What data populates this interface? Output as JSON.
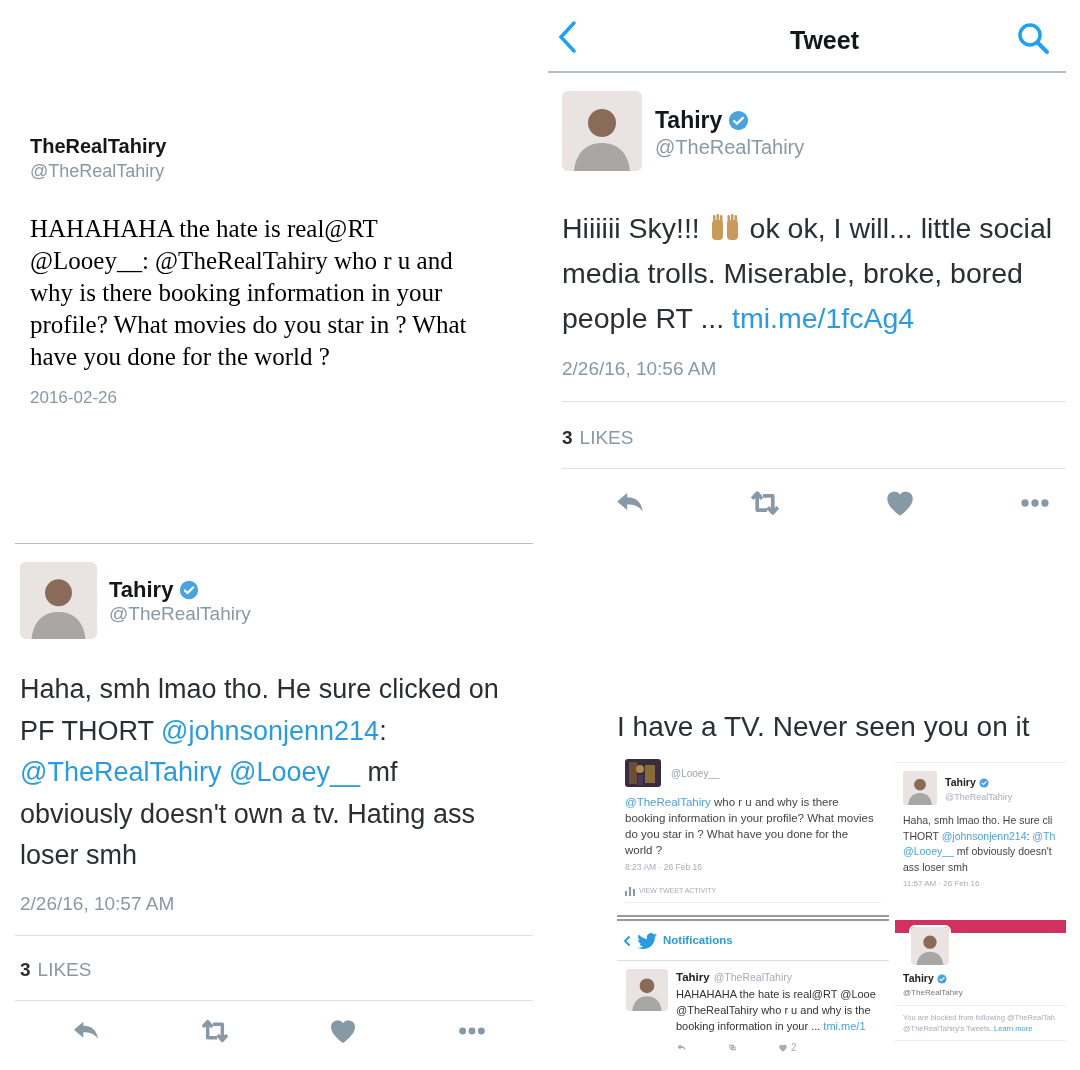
{
  "quote_card": {
    "name": "TheRealTahiry",
    "handle": "@TheRealTahiry",
    "text": "HAHAHAHA the hate is real@RT @Looey__: @TheRealTahiry who r u and why is there booking information in your profile? What movies do you star in ? What have you done for the world ?",
    "date": "2016-02-26"
  },
  "tweet_detail": {
    "header_title": "Tweet",
    "name": "Tahiry",
    "verified": true,
    "handle": "@TheRealTahiry",
    "lines": [
      [
        {
          "kind": "plain",
          "text": "Hiiiiii Sky!!! "
        },
        {
          "kind": "raised_hands"
        },
        {
          "kind": "plain",
          "text": " ok ok, I will... little social"
        }
      ],
      [
        {
          "kind": "plain",
          "text": "media trolls. Miserable, broke, bored"
        }
      ],
      [
        {
          "kind": "plain",
          "text": "people RT ... "
        },
        {
          "kind": "link",
          "text": "tmi.me/1fcAg4"
        }
      ]
    ],
    "timestamp": "2/26/16, 10:56 AM",
    "likes_count": "3",
    "likes_label": "LIKES"
  },
  "reply_tweet": {
    "name": "Tahiry",
    "verified": true,
    "handle": "@TheRealTahiry",
    "lines": [
      [
        {
          "kind": "plain",
          "text": "Haha, smh lmao tho. He sure clicked on"
        }
      ],
      [
        {
          "kind": "plain",
          "text": "PF THORT "
        },
        {
          "kind": "link",
          "text": "@johnsonjenn214"
        },
        {
          "kind": "plain",
          "text": ":"
        }
      ],
      [
        {
          "kind": "link",
          "text": "@TheRealTahiry"
        },
        {
          "kind": "space"
        },
        {
          "kind": "link",
          "text": "@Looey__"
        },
        {
          "kind": "plain",
          "text": " mf"
        }
      ],
      [
        {
          "kind": "plain",
          "text": "obviously doesn't own a tv. Hating ass"
        }
      ],
      [
        {
          "kind": "plain",
          "text": "loser smh"
        }
      ]
    ],
    "timestamp": "2/26/16, 10:57 AM",
    "likes_count": "3",
    "likes_label": "LIKES"
  },
  "caption": "I have a TV. Never seen you on it",
  "mini_looey": {
    "handle": "@Looey__",
    "lines": [
      [
        {
          "kind": "link",
          "text": "@TheRealTahiry"
        },
        {
          "kind": "plain",
          "text": " who r u and why is there"
        }
      ],
      [
        {
          "kind": "plain",
          "text": "booking information in your profile? What movies"
        }
      ],
      [
        {
          "kind": "plain",
          "text": "do you star in ? What have you done for the"
        }
      ],
      [
        {
          "kind": "plain",
          "text": "world ?"
        }
      ]
    ],
    "timestamp": "8:23 AM · 26 Feb 16",
    "activity": "VIEW TWEET ACTIVITY"
  },
  "mini_tweet": {
    "name": "Tahiry",
    "verified": true,
    "handle": "@TheRealTahiry",
    "lines": [
      [
        {
          "kind": "plain",
          "text": "Haha, smh lmao tho. He sure cli"
        }
      ],
      [
        {
          "kind": "plain",
          "text": "THORT "
        },
        {
          "kind": "link",
          "text": "@johnsonjenn214"
        },
        {
          "kind": "plain",
          "text": ": "
        },
        {
          "kind": "link",
          "text": "@Th"
        }
      ],
      [
        {
          "kind": "link",
          "text": "@Looey__"
        },
        {
          "kind": "plain",
          "text": " mf obviously doesn't"
        }
      ],
      [
        {
          "kind": "plain",
          "text": "ass loser smh"
        }
      ]
    ],
    "timestamp": "11:57 AM · 26 Feb 16"
  },
  "mini_notifications": {
    "title": "Notifications",
    "name": "Tahiry",
    "handle": "@TheRealTahiry",
    "lines": [
      [
        {
          "kind": "plain",
          "text": "HAHAHAHA the hate is real@RT @Looe"
        }
      ],
      [
        {
          "kind": "plain",
          "text": "@TheRealTahiry who r u and why is the"
        }
      ],
      [
        {
          "kind": "plain",
          "text": "booking information in your ... "
        },
        {
          "kind": "link",
          "text": "tmi.me/1"
        }
      ]
    ],
    "like_count": "2"
  },
  "mini_profile": {
    "name": "Tahiry",
    "verified": true,
    "handle": "@TheRealTahiry",
    "notice_lines": [
      [
        {
          "kind": "plain",
          "text": "You are blocked from following @TheRealTah"
        }
      ],
      [
        {
          "kind": "plain",
          "text": "@TheRealTahiry's Tweets. "
        },
        {
          "kind": "link",
          "text": "Learn more"
        }
      ]
    ]
  }
}
